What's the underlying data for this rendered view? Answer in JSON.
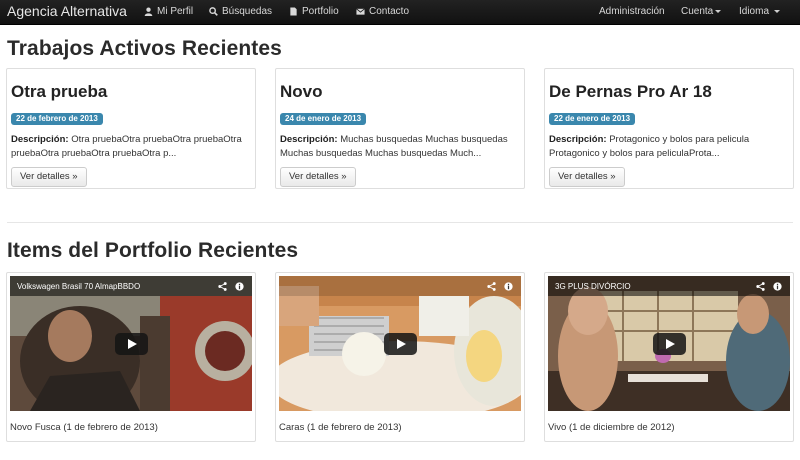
{
  "navbar": {
    "brand": "Agencia Alternativa",
    "items": [
      {
        "label": "Mi Perfil",
        "icon": "user-icon"
      },
      {
        "label": "Búsquedas",
        "icon": "search-icon"
      },
      {
        "label": "Portfolio",
        "icon": "document-icon"
      },
      {
        "label": "Contacto",
        "icon": "envelope-icon"
      }
    ],
    "right_items": [
      {
        "label": "Administración"
      },
      {
        "label": "Cuenta",
        "dropdown": true
      },
      {
        "label": "Idioma",
        "dropdown": true
      }
    ]
  },
  "jobs_section": {
    "title": "Trabajos Activos Recientes",
    "cards": [
      {
        "title": "Otra prueba",
        "date": "22 de febrero de 2013",
        "desc_label": "Descripción:",
        "desc_text": "Otra pruebaOtra pruebaOtra pruebaOtra pruebaOtra pruebaOtra pruebaOtra p...",
        "button": "Ver detalles »"
      },
      {
        "title": "Novo",
        "date": "24 de enero de 2013",
        "desc_label": "Descripción:",
        "desc_text": "Muchas busquedas Muchas busquedas Muchas busquedas Muchas busquedas Much...",
        "button": "Ver detalles »"
      },
      {
        "title": "De Pernas Pro Ar 18",
        "date": "22 de enero de 2013",
        "desc_label": "Descripción:",
        "desc_text": "Protagonico y bolos para pelicula Protagonico y bolos para peliculaProta...",
        "button": "Ver detalles »"
      }
    ]
  },
  "portfolio_section": {
    "title": "Items del Portfolio Recientes",
    "cards": [
      {
        "video_title": "Volkswagen Brasil 70 AlmapBBDO",
        "caption": "Novo Fusca (1 de febrero de 2013)"
      },
      {
        "video_title": "",
        "caption": "Caras (1 de febrero de 2013)"
      },
      {
        "video_title": "3G PLUS DIVÓRCIO",
        "caption": "Vivo (1 de diciembre de 2012)"
      }
    ]
  },
  "colors": {
    "navbar_bg": "#1b1b1b",
    "badge_bg": "#3a87ad"
  }
}
